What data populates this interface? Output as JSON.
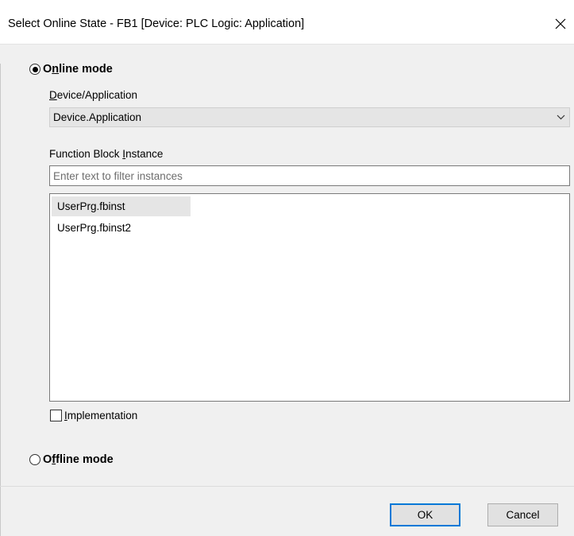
{
  "window": {
    "title": "Select Online State - FB1 [Device: PLC Logic: Application]",
    "close_glyph": "✕"
  },
  "online_mode": {
    "label_pre": "O",
    "label_mnemonic": "n",
    "label_post": "line mode",
    "checked": true
  },
  "device_application": {
    "label_mnemonic": "D",
    "label_post": "evice/Application",
    "selected_value": "Device.Application"
  },
  "function_block_instance": {
    "label_pre": "Function Block ",
    "label_mnemonic": "I",
    "label_post": "nstance"
  },
  "filter": {
    "placeholder": "Enter text to filter instances",
    "value": ""
  },
  "instances": [
    {
      "label": "UserPrg.fbinst",
      "selected": true
    },
    {
      "label": "UserPrg.fbinst2",
      "selected": false
    }
  ],
  "implementation": {
    "label_mnemonic": "I",
    "label_post": "mplementation",
    "checked": false
  },
  "offline_mode": {
    "label_pre": "O",
    "label_mnemonic": "f",
    "label_post": "fline mode",
    "checked": false
  },
  "buttons": {
    "ok": "OK",
    "cancel": "Cancel"
  },
  "colors": {
    "default_button_border": "#0078d7",
    "selected_item_bg": "#e5e5e5",
    "dialog_bg": "#f0f0f0"
  }
}
